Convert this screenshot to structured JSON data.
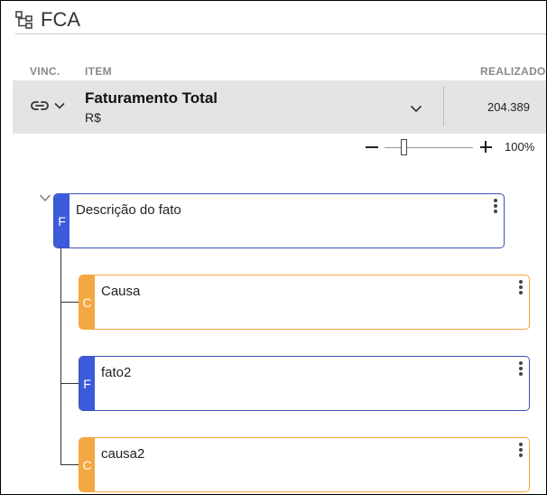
{
  "header": {
    "title": "FCA",
    "icon": "hierarchy-icon"
  },
  "columns": {
    "vinc": "VINC.",
    "item": "ITEM",
    "realizado": "REALIZADO"
  },
  "indicator_row": {
    "name": "Faturamento Total",
    "unit": "R$",
    "realizado_value": "204.389"
  },
  "zoom": {
    "level": "100%",
    "slider_fraction": 0.22
  },
  "tree": {
    "root": {
      "type_letter": "F",
      "label": "Descrição do fato"
    },
    "children": [
      {
        "type_letter": "C",
        "label": "Causa"
      },
      {
        "type_letter": "F",
        "label": "fato2"
      },
      {
        "type_letter": "C",
        "label": "causa2"
      }
    ]
  },
  "colors": {
    "fato": "#3b5bdb",
    "causa": "#f5a742",
    "row_bg": "#e4e4e4"
  }
}
